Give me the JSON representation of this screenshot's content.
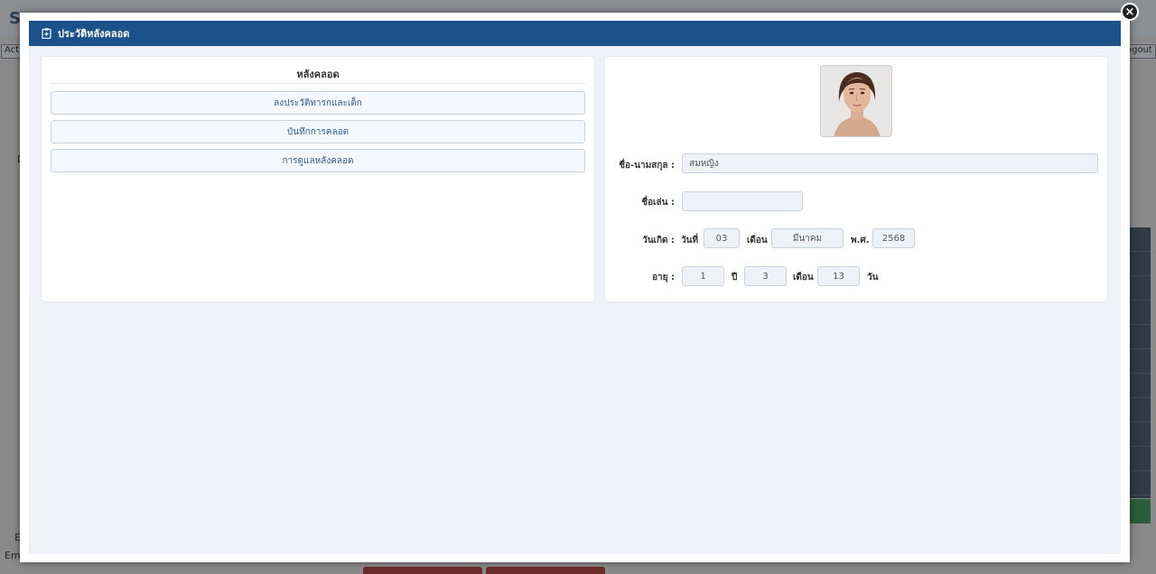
{
  "background": {
    "brand": "S",
    "tab_left": "Acti",
    "tab_right": "ogout",
    "label_left_1": "D",
    "label_left_2": "E",
    "label_left_3": "Em"
  },
  "modal": {
    "title": "ประวัติหลังคลอด",
    "header_icon": "clipboard-icon",
    "close_icon": "close-icon",
    "header_color": "#1b5289"
  },
  "left_panel": {
    "title": "หลังคลอด",
    "buttons": [
      {
        "label": "ลงประวัติทารกและเด็ก"
      },
      {
        "label": "บันทึกการคลอด"
      },
      {
        "label": "การดูแลหลังคลอด"
      }
    ]
  },
  "right_panel": {
    "photo_alt": "portrait-photo",
    "name_label": "ชื่อ-นามสกุล :",
    "name_value": "สมหญิง",
    "nickname_label": "ชื่อเล่น :",
    "nickname_value": "",
    "birth_label": "วันเกิด :",
    "day_label": "วันที่",
    "day_value": "03",
    "month_label": "เดือน",
    "month_value": "มีนาคม",
    "year_label": "พ.ศ.",
    "year_value": "2568",
    "age_label": "อายุ :",
    "age_years": "1",
    "years_unit": "ปี",
    "age_months": "3",
    "months_unit": "เดือน",
    "age_days": "13",
    "days_unit": "วัน"
  }
}
